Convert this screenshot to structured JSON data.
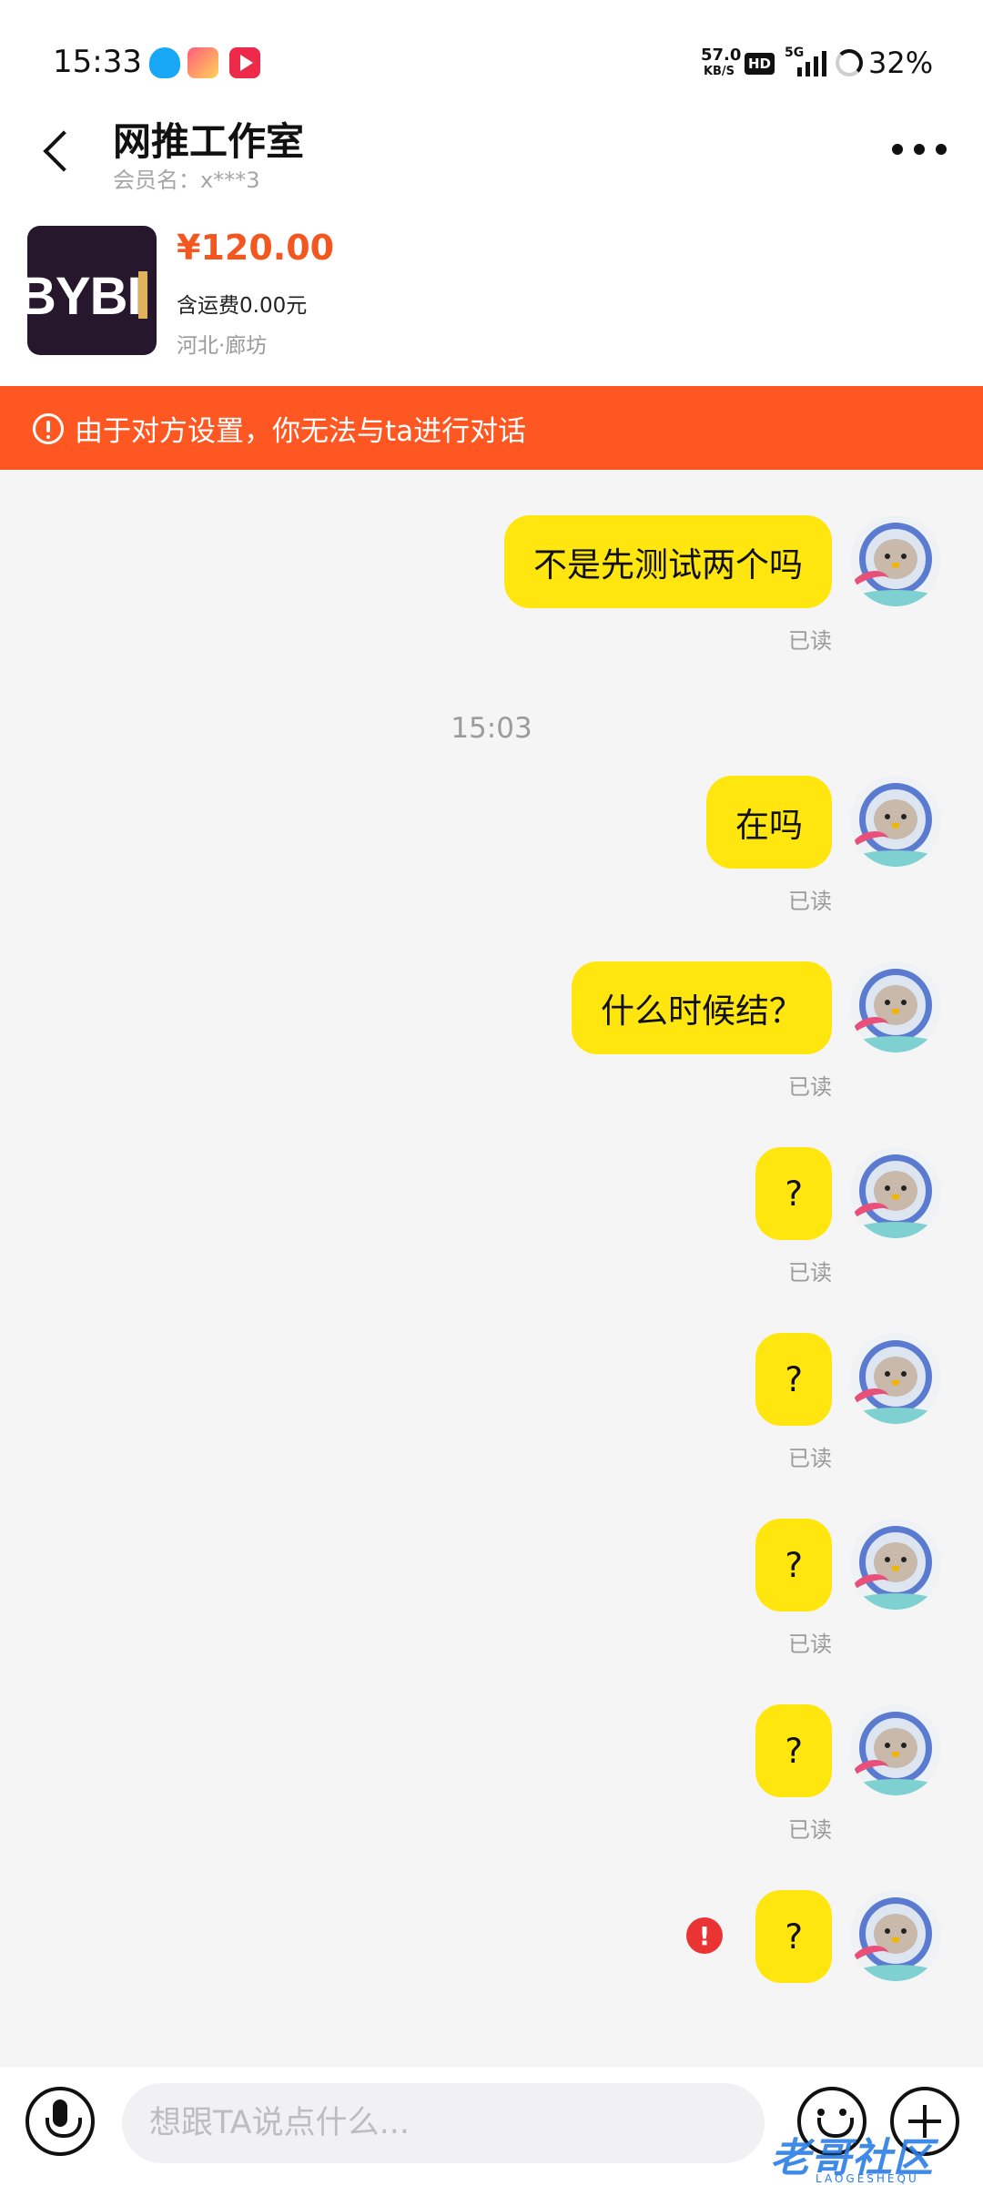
{
  "status_bar": {
    "time": "15:33",
    "net_speed": "57.0",
    "net_unit": "KB/S",
    "hd": "HD",
    "network": "5G",
    "battery": "32%"
  },
  "header": {
    "shop_name": "网推工作室",
    "member": "会员名：x***3"
  },
  "product": {
    "thumb_text": "BYBI",
    "price": "¥120.00",
    "shipping": "含运费0.00元",
    "location": "河北·廊坊"
  },
  "warning": {
    "text": "由于对方设置，你无法与ta进行对话"
  },
  "messages": [
    {
      "text": "不是先测试两个吗",
      "status": "已读"
    },
    {
      "text": "在吗",
      "status": "已读"
    },
    {
      "text": "什么时候结？",
      "status": "已读"
    },
    {
      "text": "?",
      "status": "已读"
    },
    {
      "text": "?",
      "status": "已读"
    },
    {
      "text": "?",
      "status": "已读"
    },
    {
      "text": "?",
      "status": "已读"
    },
    {
      "text": "?",
      "status": ""
    }
  ],
  "timestamp": "15:03",
  "fail_mark": "!",
  "input": {
    "placeholder": "想跟TA说点什么..."
  },
  "watermark": {
    "text": "老哥社区",
    "sub": "LAOGESHEQU"
  },
  "colors": {
    "accent": "#ff5722",
    "bubble": "#ffe60f",
    "price": "#f3571f"
  }
}
